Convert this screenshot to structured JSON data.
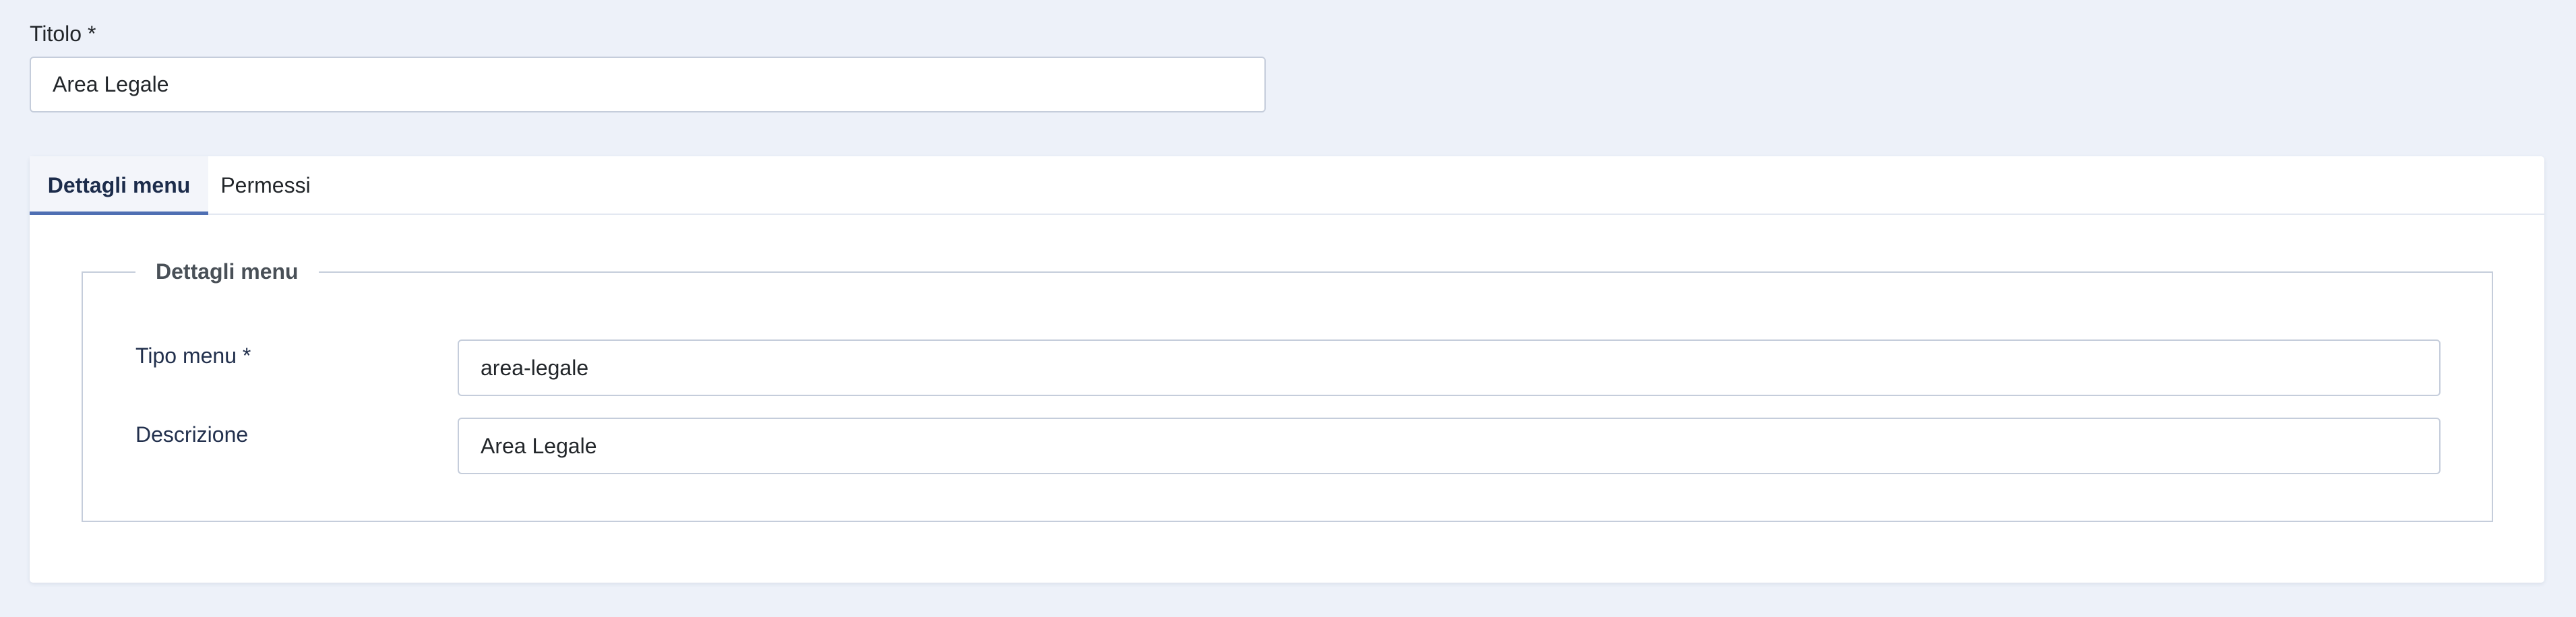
{
  "title_field": {
    "label": "Titolo *",
    "value": "Area Legale"
  },
  "tabs": [
    {
      "label": "Dettagli menu",
      "active": true
    },
    {
      "label": "Permessi",
      "active": false
    }
  ],
  "details": {
    "legend": "Dettagli menu",
    "menu_type": {
      "label": "Tipo menu *",
      "value": "area-legale"
    },
    "description": {
      "label": "Descrizione",
      "value": "Area Legale"
    }
  },
  "colors": {
    "page_background": "#edf1f9",
    "active_tab_underline": "#4f6fb3",
    "input_border": "#c5cddb"
  }
}
